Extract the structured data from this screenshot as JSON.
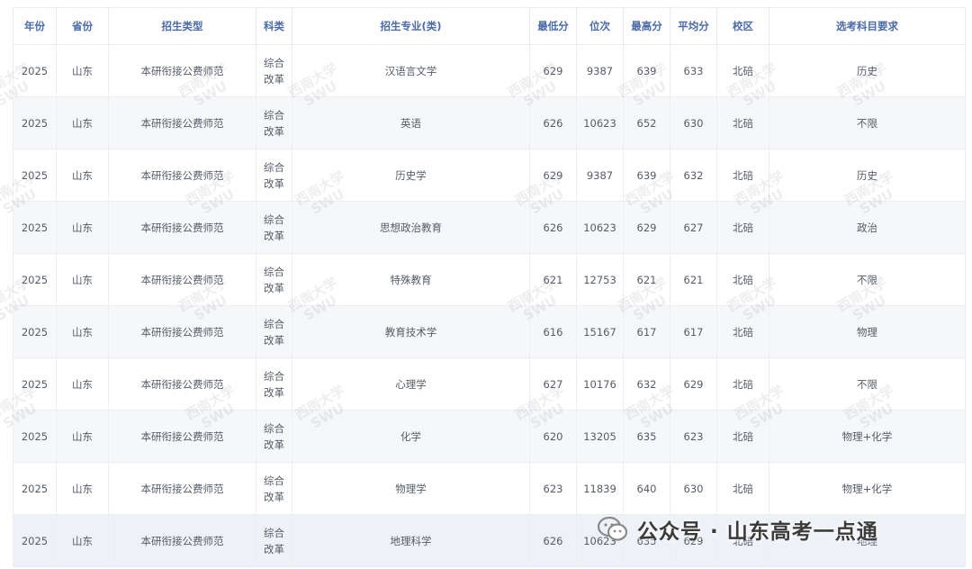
{
  "table": {
    "headers": [
      "年份",
      "省份",
      "招生类型",
      "科类",
      "招生专业(类)",
      "最低分",
      "位次",
      "最高分",
      "平均分",
      "校区",
      "选考科目要求"
    ],
    "rows": [
      {
        "year": "2025",
        "province": "山东",
        "type": "本研衔接公费师范",
        "subject_line1": "综合",
        "subject_line2": "改革",
        "major": "汉语言文学",
        "min_score": "629",
        "rank": "9387",
        "max_score": "639",
        "avg_score": "633",
        "campus": "北碚",
        "requirement": "历史"
      },
      {
        "year": "2025",
        "province": "山东",
        "type": "本研衔接公费师范",
        "subject_line1": "综合",
        "subject_line2": "改革",
        "major": "英语",
        "min_score": "626",
        "rank": "10623",
        "max_score": "652",
        "avg_score": "630",
        "campus": "北碚",
        "requirement": "不限"
      },
      {
        "year": "2025",
        "province": "山东",
        "type": "本研衔接公费师范",
        "subject_line1": "综合",
        "subject_line2": "改革",
        "major": "历史学",
        "min_score": "629",
        "rank": "9387",
        "max_score": "639",
        "avg_score": "632",
        "campus": "北碚",
        "requirement": "历史"
      },
      {
        "year": "2025",
        "province": "山东",
        "type": "本研衔接公费师范",
        "subject_line1": "综合",
        "subject_line2": "改革",
        "major": "思想政治教育",
        "min_score": "626",
        "rank": "10623",
        "max_score": "629",
        "avg_score": "627",
        "campus": "北碚",
        "requirement": "政治"
      },
      {
        "year": "2025",
        "province": "山东",
        "type": "本研衔接公费师范",
        "subject_line1": "综合",
        "subject_line2": "改革",
        "major": "特殊教育",
        "min_score": "621",
        "rank": "12753",
        "max_score": "621",
        "avg_score": "621",
        "campus": "北碚",
        "requirement": "不限"
      },
      {
        "year": "2025",
        "province": "山东",
        "type": "本研衔接公费师范",
        "subject_line1": "综合",
        "subject_line2": "改革",
        "major": "教育技术学",
        "min_score": "616",
        "rank": "15167",
        "max_score": "617",
        "avg_score": "617",
        "campus": "北碚",
        "requirement": "物理"
      },
      {
        "year": "2025",
        "province": "山东",
        "type": "本研衔接公费师范",
        "subject_line1": "综合",
        "subject_line2": "改革",
        "major": "心理学",
        "min_score": "627",
        "rank": "10176",
        "max_score": "632",
        "avg_score": "629",
        "campus": "北碚",
        "requirement": "不限"
      },
      {
        "year": "2025",
        "province": "山东",
        "type": "本研衔接公费师范",
        "subject_line1": "综合",
        "subject_line2": "改革",
        "major": "化学",
        "min_score": "620",
        "rank": "13205",
        "max_score": "635",
        "avg_score": "623",
        "campus": "北碚",
        "requirement": "物理+化学"
      },
      {
        "year": "2025",
        "province": "山东",
        "type": "本研衔接公费师范",
        "subject_line1": "综合",
        "subject_line2": "改革",
        "major": "物理学",
        "min_score": "623",
        "rank": "11839",
        "max_score": "640",
        "avg_score": "630",
        "campus": "北碚",
        "requirement": "物理+化学"
      },
      {
        "year": "2025",
        "province": "山东",
        "type": "本研衔接公费师范",
        "subject_line1": "综合",
        "subject_line2": "改革",
        "major": "地理科学",
        "min_score": "626",
        "rank": "10623",
        "max_score": "635",
        "avg_score": "629",
        "campus": "北碚",
        "requirement": "地理"
      }
    ]
  },
  "watermark": {
    "line1": "西南大学",
    "line2": "SWU"
  },
  "overlay": {
    "account_label": "公众号 · 山东高考一点通",
    "icon": "wechat-icon"
  },
  "colors": {
    "header_text": "#4a6aa8",
    "body_text": "#555c66",
    "stripe": "#f6f7f9",
    "border": "#eceef2"
  }
}
